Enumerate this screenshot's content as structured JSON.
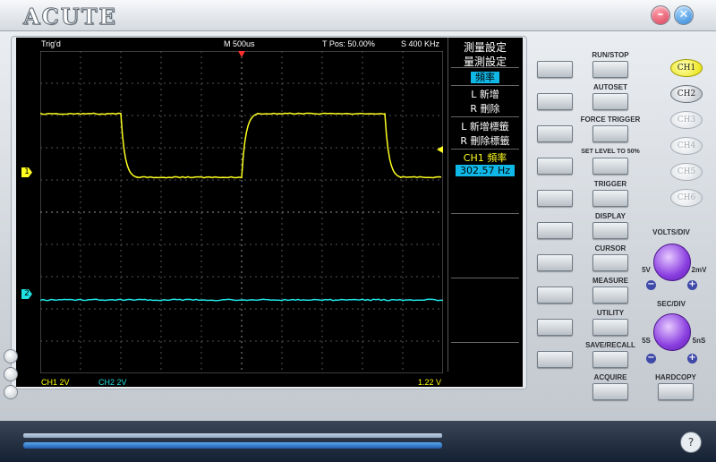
{
  "app": {
    "logo_text": "ACUTE"
  },
  "window": {
    "minimize_symbol": "–",
    "close_symbol": "✕"
  },
  "status": {
    "trig": "Trig'd",
    "timebase": "M 500us",
    "tpos": "T Pos: 50.00%",
    "sample": "S 400 KHz"
  },
  "footer": {
    "ch1": "CH1  2V",
    "ch2": "CH2  2V",
    "trigger_level": "1.22 V"
  },
  "markers": {
    "ch1": "1",
    "ch2": "2",
    "trigger_pos_icon": "trigger-arrow-icon",
    "trigger_level_icon": "trigger-level-arrow-icon"
  },
  "menu": {
    "title": "測量設定",
    "measure_setting": "量測設定",
    "selected": "頻率",
    "add": "L 新增",
    "delete": "R 刪除",
    "add_label": "L 新增標籤",
    "delete_label": "R 刪除標籤",
    "ch_reading": "CH1 頻率",
    "value": "302.57 Hz"
  },
  "controls": {
    "run_stop": "RUN/STOP",
    "autoset": "AUTOSET",
    "force_trigger": "FORCE TRIGGER",
    "set_level": "SET LEVEL TO 50%",
    "trigger": "TRIGGER",
    "display": "DISPLAY",
    "cursor": "CURSOR",
    "measure": "MEASURE",
    "utility": "UTILITY",
    "save_recall": "SAVE/RECALL",
    "acquire": "ACQUIRE",
    "hardcopy": "HARDCOPY"
  },
  "channels": [
    "CH1",
    "CH2",
    "CH3",
    "CH4",
    "CH5",
    "CH6"
  ],
  "volts": {
    "title": "VOLTS/DIV",
    "left": "5V",
    "right": "2mV"
  },
  "sec": {
    "title": "SEC/DIV",
    "left": "5S",
    "right": "5nS"
  },
  "signs": {
    "minus": "−",
    "plus": "+"
  },
  "help_symbol": "?",
  "colors": {
    "ch1": "#ffff20",
    "ch2": "#20e0e0",
    "accent": "#10b8e8"
  }
}
